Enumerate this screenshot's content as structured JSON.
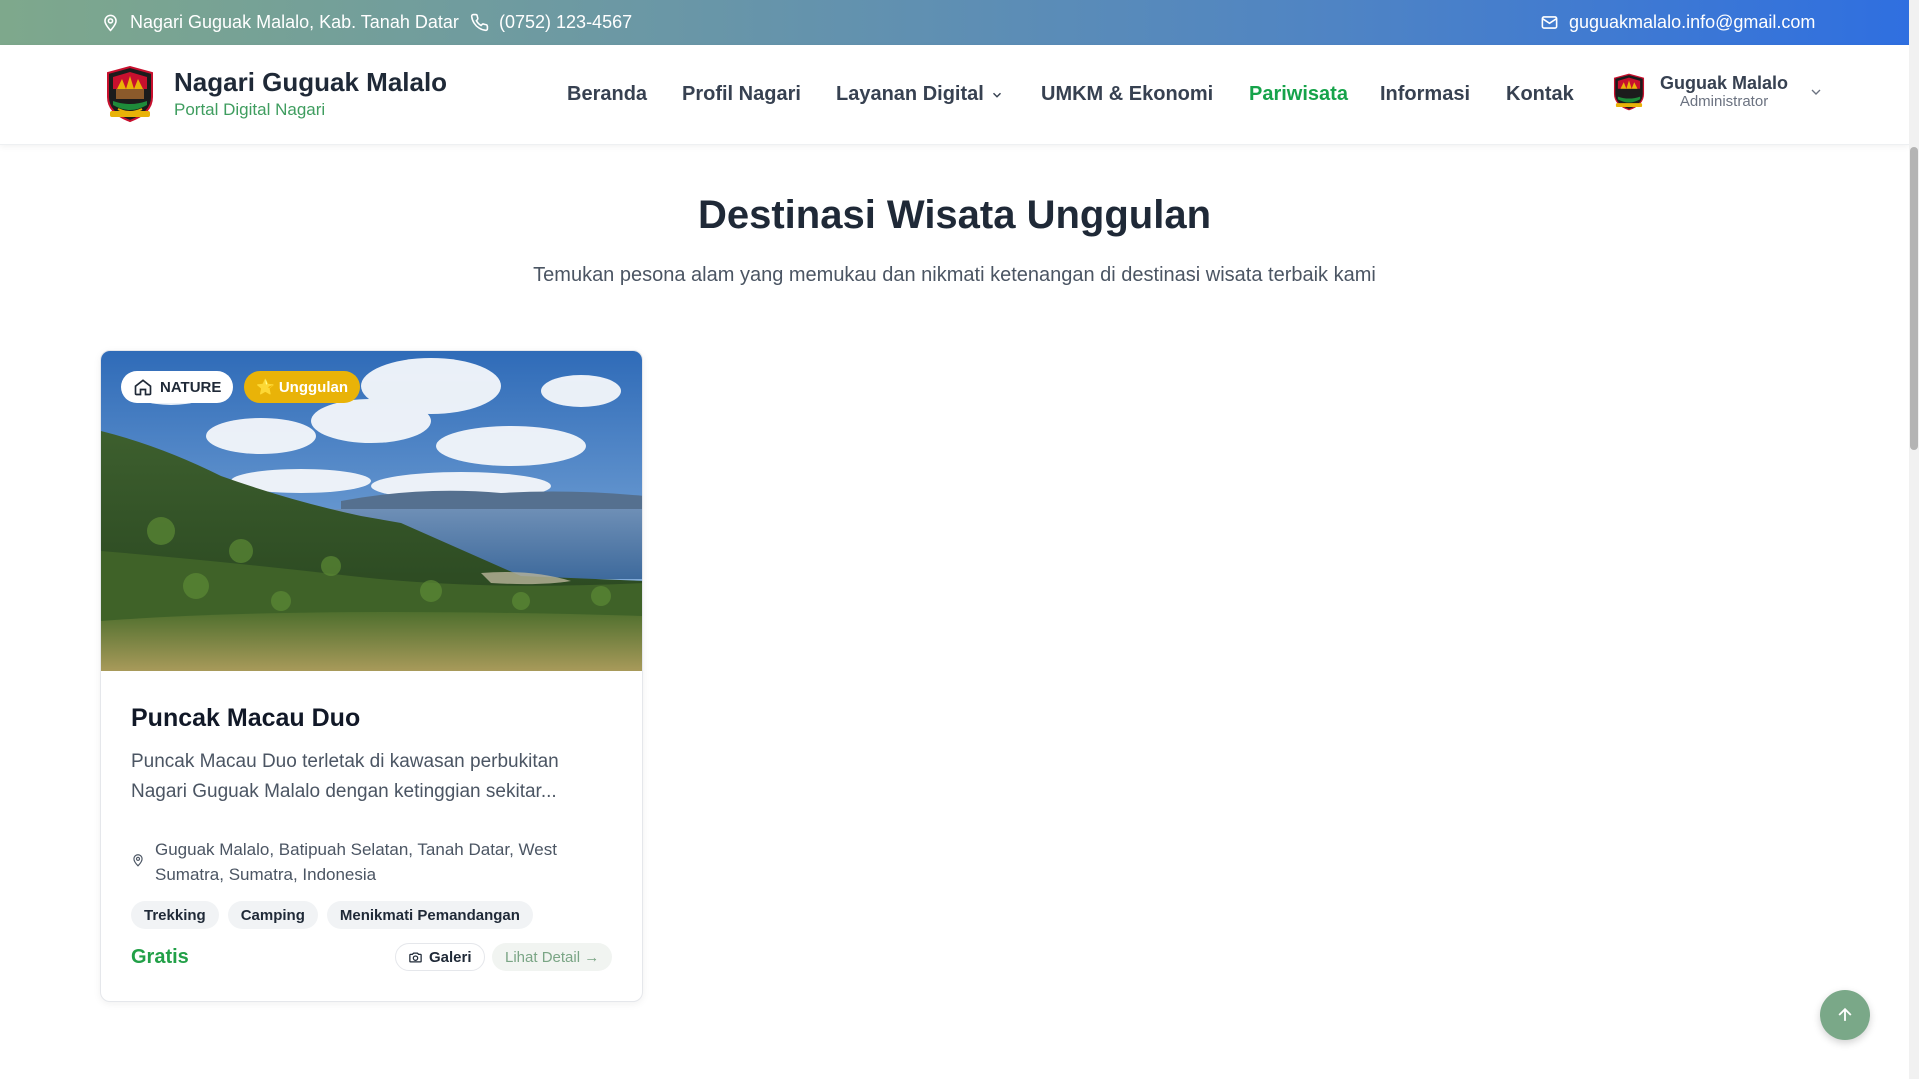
{
  "topbar": {
    "address": "Nagari Guguak Malalo, Kab. Tanah Datar",
    "phone": "(0752) 123-4567",
    "email": "guguakmalalo.info@gmail.com"
  },
  "brand": {
    "title": "Nagari Guguak Malalo",
    "subtitle": "Portal Digital Nagari"
  },
  "nav": {
    "items": [
      "Beranda",
      "Profil Nagari",
      "Layanan Digital",
      "UMKM & Ekonomi",
      "Pariwisata",
      "Informasi",
      "Kontak"
    ],
    "active": "Pariwisata"
  },
  "user": {
    "name": "Guguak Malalo",
    "role": "Administrator"
  },
  "section": {
    "title": "Destinasi Wisata Unggulan",
    "subtitle": "Temukan pesona alam yang memukau dan nikmati ketenangan di destinasi wisata terbaik kami"
  },
  "destinations": [
    {
      "category": "NATURE",
      "category_icon": "home-icon",
      "featured_label": "⭐ Unggulan",
      "title": "Puncak Macau Duo",
      "description": "Puncak Macau Duo terletak di kawasan perbukitan Nagari Guguak Malalo dengan ketinggian sekitar...",
      "location": "Guguak Malalo, Batipuah Selatan, Tanah Datar, West Sumatra, Sumatra, Indonesia",
      "tags": [
        "Trekking",
        "Camping",
        "Menikmati Pemandangan"
      ],
      "price": "Gratis",
      "gallery_label": "Galeri",
      "detail_label": "Lihat Detail →"
    }
  ],
  "colors": {
    "accent_green": "#16a34a",
    "featured_yellow": "#e9b308",
    "topbar_start": "#7ea88c",
    "topbar_end": "#2f6fe0",
    "to_top_button": "#7aa888"
  }
}
